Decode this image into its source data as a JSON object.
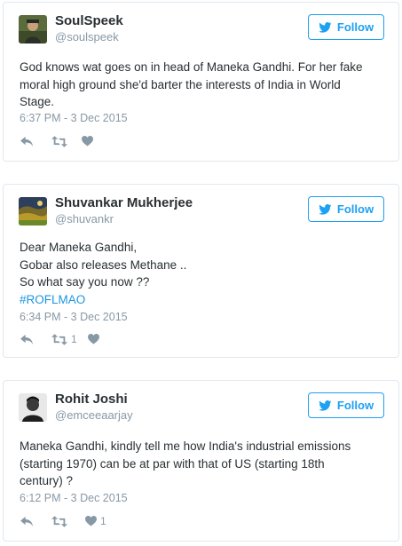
{
  "follow_label": "Follow",
  "colors": {
    "accent": "#1da1f2",
    "hashtag": "#1b95e0",
    "muted": "#8899a6",
    "text": "#292f33",
    "border": "#e1e8ed"
  },
  "tweets": [
    {
      "name": "SoulSpeek",
      "handle": "@soulspeek",
      "lines": [
        "God knows wat goes on in head of Maneka Gandhi. For her fake",
        "moral high ground she'd barter the interests of India in World",
        "Stage."
      ],
      "time": "6:37 PM - 3 Dec 2015",
      "retweets": "",
      "likes": ""
    },
    {
      "name": "Shuvankar Mukherjee",
      "handle": "@shuvankr",
      "lines": [
        "Dear Maneka Gandhi,",
        "Gobar also releases Methane ..",
        "So what say you now ??"
      ],
      "hashtag": "#ROFLMAO",
      "time": "6:34 PM - 3 Dec 2015",
      "retweets": "1",
      "likes": ""
    },
    {
      "name": "Rohit Joshi",
      "handle": "@emceeaarjay",
      "lines": [
        "Maneka Gandhi, kindly tell me how India's industrial emissions",
        "(starting 1970) can be at par with that of US (starting 18th",
        "century) ?"
      ],
      "time": "6:12 PM - 3 Dec 2015",
      "retweets": "",
      "likes": "1"
    }
  ]
}
